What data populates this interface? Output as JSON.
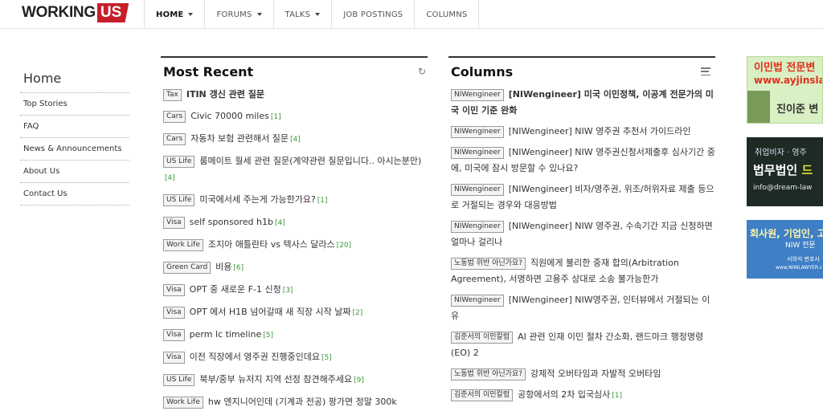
{
  "logo": {
    "part1": "WORKING",
    "part2": "US"
  },
  "nav": [
    {
      "label": "HOME",
      "dropdown": true,
      "active": true
    },
    {
      "label": "FORUMS",
      "dropdown": true
    },
    {
      "label": "TALKS",
      "dropdown": true
    },
    {
      "label": "JOB POSTINGS",
      "dropdown": false
    },
    {
      "label": "COLUMNS",
      "dropdown": false
    }
  ],
  "sidebar": {
    "title": "Home",
    "items": [
      "Top Stories",
      "FAQ",
      "News & Announcements",
      "About Us",
      "Contact Us"
    ]
  },
  "most_recent": {
    "title": "Most Recent",
    "items": [
      {
        "tag": "Tax",
        "text": "ITIN 갱신 관련 질문",
        "count": "",
        "bold": true
      },
      {
        "tag": "Cars",
        "text": "Civic 70000 miles",
        "count": "[1]"
      },
      {
        "tag": "Cars",
        "text": "자동차 보험 관련해서 질문",
        "count": "[4]"
      },
      {
        "tag": "US Life",
        "text": "룸메이트 월세 관련 질문(계약관련 질문입니다.. 아시는분만)",
        "count": "[4]"
      },
      {
        "tag": "US Life",
        "text": "미국에서세 주는게 가능한가요?",
        "count": "[1]"
      },
      {
        "tag": "Visa",
        "text": "self sponsored h1b",
        "count": "[4]"
      },
      {
        "tag": "Work Life",
        "text": "조지아 애틀란타 vs 텍사스 달라스",
        "count": "[20]"
      },
      {
        "tag": "Green Card",
        "text": "비용",
        "count": "[6]"
      },
      {
        "tag": "Visa",
        "text": "OPT 중 새로운 F-1 신청",
        "count": "[3]"
      },
      {
        "tag": "Visa",
        "text": "OPT 에서 H1B 넘어갈때 새 직장 시작 날짜",
        "count": "[2]"
      },
      {
        "tag": "Visa",
        "text": "perm lc timeline",
        "count": "[5]"
      },
      {
        "tag": "Visa",
        "text": "이전 직장에서 영주권 진행중인데요",
        "count": "[5]"
      },
      {
        "tag": "US Life",
        "text": "북부/중부 뉴저지 지역 선정 참견해주세요",
        "count": "[9]"
      },
      {
        "tag": "Work Life",
        "text": "hw 엔지니어인데 (기계과 전공) 팡가면 정말 300k",
        "count": ""
      }
    ]
  },
  "columns": {
    "title": "Columns",
    "items": [
      {
        "tag": "NIWengineer",
        "text": "[NIWengineer] 미국 이민정책, 이공계 전문가의 미국 이민 기준 완화",
        "bold": true
      },
      {
        "tag": "NIWengineer",
        "text": "[NIWengineer] NIW 영주권 추천서 가이드라인"
      },
      {
        "tag": "NIWengineer",
        "text": "[NIWengineer] NIW 영주권신청서제출후 심사기간 중에, 미국에 잠시 방문할 수 있나요?"
      },
      {
        "tag": "NIWengineer",
        "text": "[NIWengineer] 비자/영주권, 위조/허위자료 제출 등으로 거절되는 경우와 대응방법"
      },
      {
        "tag": "NIWengineer",
        "text": "[NIWengineer] NIW 영주권, 수속기간 지금 신청하면 얼마나 걸리나"
      },
      {
        "tag": "노동법 위반 아닌가요?",
        "text": "직원에게 불리한 중재 합의(Arbitration Agreement), 서명하면 고용주 상대로 소송 불가능한가"
      },
      {
        "tag": "NIWengineer",
        "text": "[NIWengineer] NIW영주권, 인터뷰에서 거절되는 이유"
      },
      {
        "tag": "김준서의 이민칼럼",
        "text": "AI 관련 인재 이민 절차 간소화, 랜드마크 행정명령(EO) 2"
      },
      {
        "tag": "노동법 위반 아닌가요?",
        "text": "강제적 오버타임과 자발적 오버타임"
      },
      {
        "tag": "김준서의 이민칼럼",
        "text": "공항에서의 2차 입국심사",
        "count": "[1]"
      }
    ]
  },
  "ads": {
    "ad1": {
      "line1": "이민법 전문변",
      "line2": "www.ayjinslaw.c",
      "line3": "진이준 변"
    },
    "ad2": {
      "line1": "취업비자 · 영주",
      "line2a": "법무법인 ",
      "line2b": "드",
      "line3": "info@dream-law"
    },
    "ad3": {
      "line1": "회사원, 기업인, 고",
      "line2": "NIW 전문",
      "line3": "서의석 변호사",
      "line4": "www.NIWLAWYER.c"
    }
  },
  "colors": {
    "accent_red": "#c5202a",
    "count_green": "#3a9a3a"
  }
}
